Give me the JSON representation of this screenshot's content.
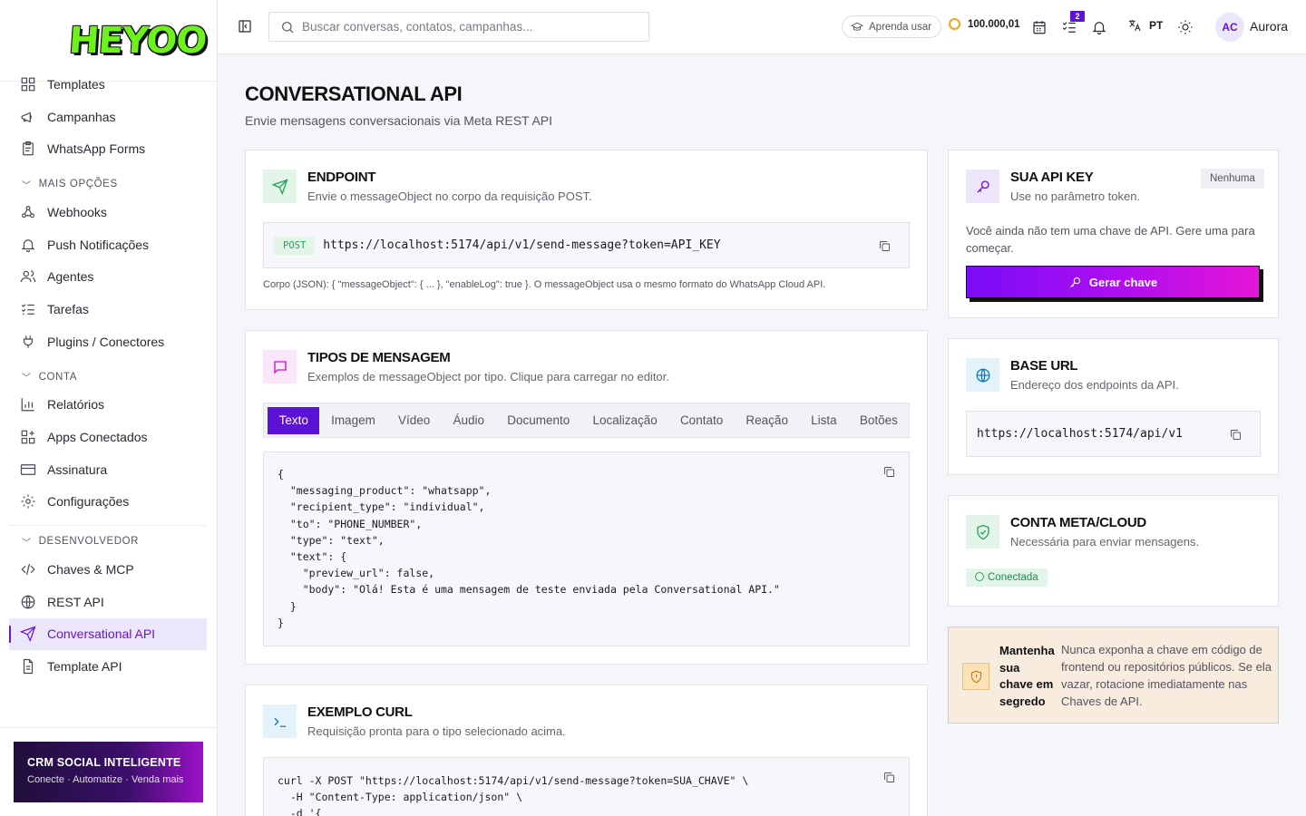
{
  "app": {
    "logo": "HEYOO",
    "username": "Aurora",
    "avatar_initials": "AC"
  },
  "sidebar": {
    "items_top": [
      {
        "label": "Templates",
        "icon": "layout-icon"
      },
      {
        "label": "Campanhas",
        "icon": "megaphone-icon"
      },
      {
        "label": "WhatsApp Forms",
        "icon": "clipboard-icon"
      }
    ],
    "sections": [
      {
        "title": "MAIS OPÇÕES",
        "items": [
          "Webhooks",
          "Push Notificações",
          "Agentes",
          "Tarefas",
          "Plugins / Conectores"
        ]
      },
      {
        "title": "CONTA",
        "items": [
          "Relatórios",
          "Apps Conectados",
          "Assinatura",
          "Configurações"
        ]
      },
      {
        "title": "DESENVOLVEDOR",
        "items": [
          "Chaves & MCP",
          "REST API",
          "Conversational API",
          "Template API"
        ]
      }
    ],
    "active_item": "Conversational API",
    "promo": {
      "title": "CRM SOCIAL INTELIGENTE",
      "subtitle": "Conecte · Automatize · Venda mais"
    }
  },
  "topbar": {
    "search_placeholder": "Buscar conversas, contatos, campanhas...",
    "learn_label": "Aprenda usar",
    "credits": "100.000,01",
    "tasks_badge": "2",
    "language": "PT"
  },
  "page": {
    "title": "CONVERSATIONAL API",
    "subtitle": "Envie mensagens conversacionais via Meta REST API"
  },
  "endpoint": {
    "title": "ENDPOINT",
    "subtitle": "Envie o messageObject no corpo da requisição POST.",
    "method": "POST",
    "url": "https://localhost:5174/api/v1/send-message?token=API_KEY",
    "note": "Corpo (JSON): { \"messageObject\": { ... }, \"enableLog\": true }. O messageObject usa o mesmo formato do WhatsApp Cloud API."
  },
  "message_types": {
    "title": "TIPOS DE MENSAGEM",
    "subtitle": "Exemplos de messageObject por tipo. Clique para carregar no editor.",
    "tabs": [
      "Texto",
      "Imagem",
      "Vídeo",
      "Áudio",
      "Documento",
      "Localização",
      "Contato",
      "Reação",
      "Lista",
      "Botões"
    ],
    "active_tab": "Texto",
    "code": "{\n  \"messaging_product\": \"whatsapp\",\n  \"recipient_type\": \"individual\",\n  \"to\": \"PHONE_NUMBER\",\n  \"type\": \"text\",\n  \"text\": {\n    \"preview_url\": false,\n    \"body\": \"Olá! Esta é uma mensagem de teste enviada pela Conversational API.\"\n  }\n}"
  },
  "curl": {
    "title": "EXEMPLO CURL",
    "subtitle": "Requisição pronta para o tipo selecionado acima.",
    "code": "curl -X POST \"https://localhost:5174/api/v1/send-message?token=SUA_CHAVE\" \\\n  -H \"Content-Type: application/json\" \\\n  -d '{"
  },
  "api_key": {
    "title": "SUA API KEY",
    "subtitle": "Use no parâmetro token.",
    "status": "Nenhuma",
    "message": "Você ainda não tem uma chave de API. Gere uma para começar.",
    "button": "Gerar chave"
  },
  "base_url": {
    "title": "BASE URL",
    "subtitle": "Endereço dos endpoints da API.",
    "url": "https://localhost:5174/api/v1"
  },
  "meta_account": {
    "title": "CONTA META/CLOUD",
    "subtitle": "Necessária para enviar mensagens.",
    "status": "Conectada"
  },
  "warning": {
    "title": "Mantenha sua chave em segredo",
    "text": "Nunca exponha a chave em código de frontend ou repositórios públicos. Se ela vazar, rotacione imediatamente nas Chaves de API."
  },
  "colors": {
    "accent": "#5b12d6",
    "success": "#27a55a",
    "warning": "#c7790b"
  }
}
